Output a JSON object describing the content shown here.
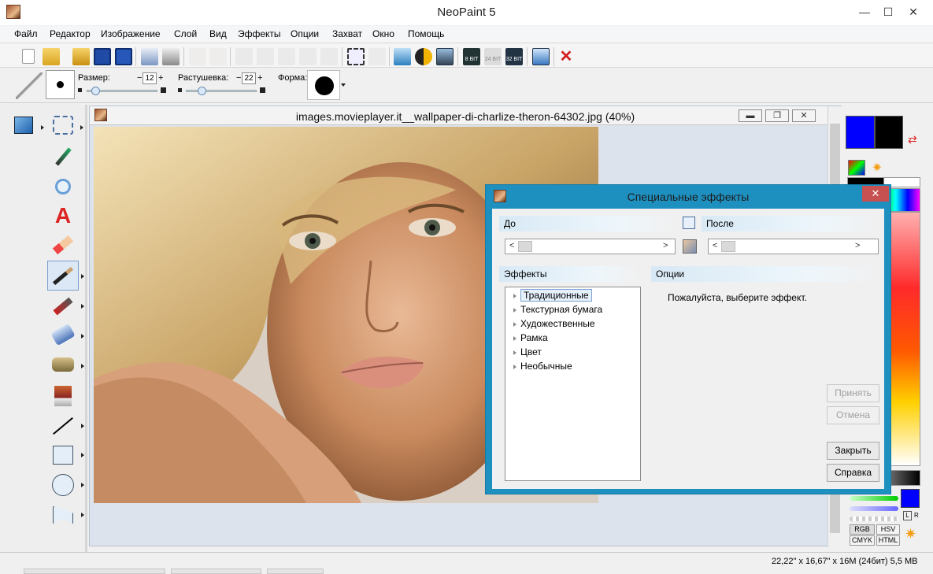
{
  "app": {
    "title": "NeoPaint 5"
  },
  "window_controls": {
    "minimize": "—",
    "maximize": "☐",
    "close": "✕"
  },
  "menu": [
    "Файл",
    "Редактор",
    "Изображение",
    "Слой",
    "Вид",
    "Эффекты",
    "Опции",
    "Захват",
    "Окно",
    "Помощь"
  ],
  "toolbar": {
    "icons": [
      "new-icon",
      "open-icon",
      "open-folder-icon",
      "save-icon",
      "save-all-icon",
      "print-preview-icon",
      "print-icon",
      "undo-icon",
      "redo-icon",
      "cut-icon",
      "copy-icon",
      "paste-icon",
      "paste-new-icon",
      "delete-icon",
      "crop-icon",
      "select-all-icon",
      "image-size-icon",
      "invert-icon",
      "adjust-icon",
      "8bit-icon",
      "24bit-icon",
      "32bit-icon",
      "screen-capture-icon",
      "close-doc-icon"
    ],
    "bit_labels": {
      "b8": "8 BIT",
      "b24": "24 BIT",
      "b32": "32 BIT"
    }
  },
  "options": {
    "size_label": "Размер:",
    "size_value": "12",
    "feather_label": "Растушевка:",
    "feather_value": "22",
    "shape_label": "Форма:",
    "minus": "−",
    "plus": "+",
    "size_slider": 0.12,
    "feather_slider": 0.22
  },
  "tools": [
    "cube-icon",
    "lasso-scissors-icon",
    "eyedropper-icon",
    "magnifier-icon",
    "text-icon",
    "eraser-icon",
    "brush-icon",
    "airbrush-icon",
    "fill-icon",
    "clone-stamp-icon",
    "stamp-icon",
    "line-icon",
    "rectangle-icon",
    "ellipse-icon",
    "polygon-icon"
  ],
  "document": {
    "title": "images.movieplayer.it__wallpaper-di-charlize-theron-64302.jpg (40%)"
  },
  "colors": {
    "primary": "#0000ff",
    "secondary": "#000000",
    "accent": "#1e90c0",
    "close_red": "#c75050"
  },
  "color_panel": {
    "modes": [
      "RGB",
      "HSV",
      "CMYK",
      "HTML"
    ],
    "l_label": "L",
    "r_label": "R"
  },
  "dialog": {
    "title": "Специальные эффекты",
    "close": "✕",
    "before_label": "До",
    "after_label": "После",
    "effects_label": "Эффекты",
    "options_label": "Опции",
    "hint": "Пожалуйста, выберите эффект.",
    "arrow_left": "<",
    "arrow_right": ">",
    "effects": [
      "Традиционные",
      "Текстурная бумага",
      "Художественные",
      "Рамка",
      "Цвет",
      "Необычные"
    ],
    "buttons": {
      "apply": "Принять",
      "cancel": "Отмена",
      "close": "Закрыть",
      "help": "Справка"
    }
  },
  "status": {
    "text": "22,22\" x 16,67\" x 16M (24бит) 5,5 MB"
  }
}
